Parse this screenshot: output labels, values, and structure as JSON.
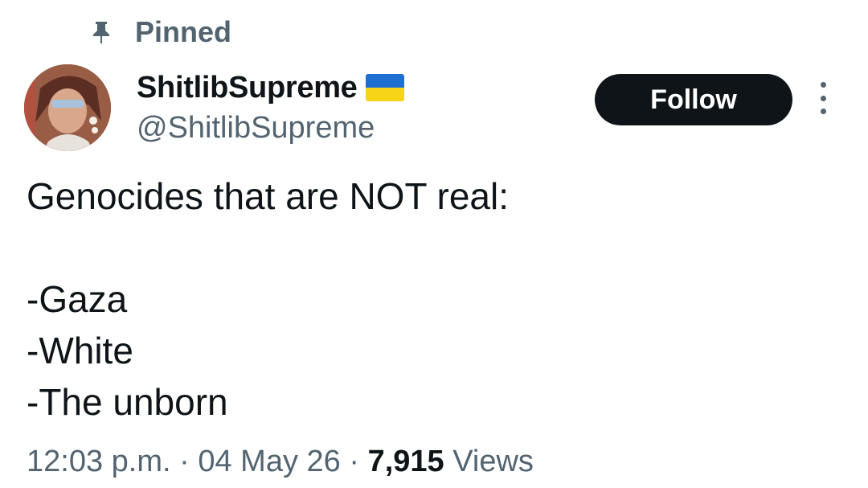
{
  "pinned": {
    "icon": "pin-icon",
    "label": "Pinned"
  },
  "author": {
    "avatar": "avatar",
    "display_name": "ShitlibSupreme",
    "flag": "ukraine-flag-icon",
    "handle": "@ShitlibSupreme"
  },
  "actions": {
    "follow_label": "Follow",
    "more_icon": "more-options-icon"
  },
  "tweet": {
    "lines": [
      "Genocides that are NOT real:",
      "",
      "-Gaza",
      "-White",
      "-The unborn"
    ]
  },
  "meta": {
    "time": "12:03 p.m.",
    "separator": "·",
    "date": "04 May 26",
    "views_count": "7,915",
    "views_label": "Views"
  },
  "colors": {
    "text_primary": "#0f1419",
    "text_secondary": "#536471",
    "follow_bg": "#0f1419",
    "flag_blue": "#1f6fd1",
    "flag_yellow": "#f7d418"
  }
}
